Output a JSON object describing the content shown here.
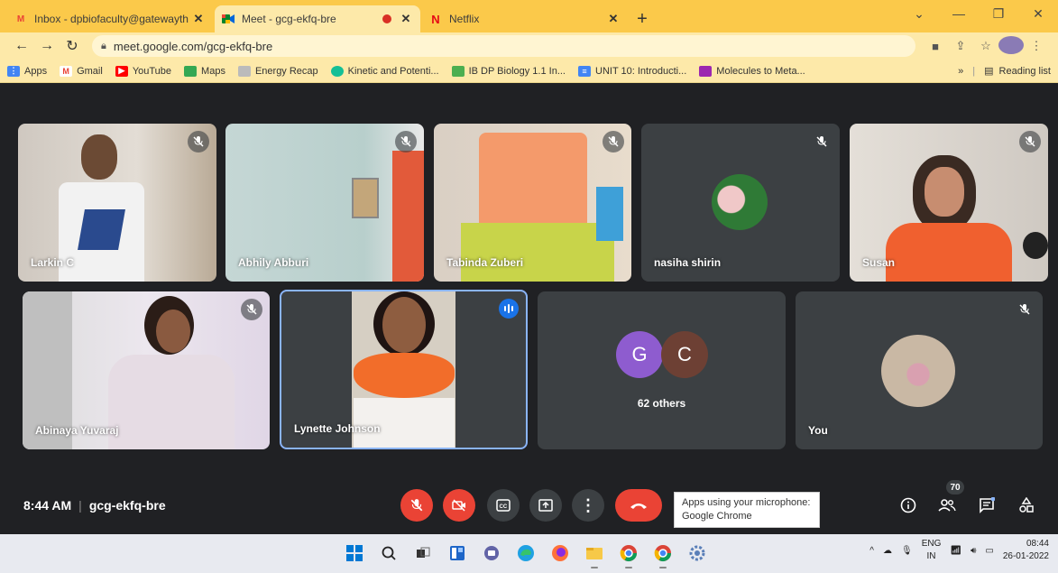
{
  "browser": {
    "tabs": [
      {
        "title": "Inbox - dpbiofaculty@gatewayth",
        "favicon": "gmail-icon",
        "active": false
      },
      {
        "title": "Meet - gcg-ekfq-bre",
        "favicon": "meet-icon",
        "active": true
      },
      {
        "title": "Netflix",
        "favicon": "netflix-icon",
        "active": false
      }
    ],
    "url": "meet.google.com/gcg-ekfq-bre",
    "bookmarks": [
      {
        "label": "Apps",
        "icon": "apps-icon",
        "color": "#4285f4"
      },
      {
        "label": "Gmail",
        "icon": "gmail-icon",
        "color": "#ea4335"
      },
      {
        "label": "YouTube",
        "icon": "youtube-icon",
        "color": "#ff0000"
      },
      {
        "label": "Maps",
        "icon": "maps-icon",
        "color": "#34a853"
      },
      {
        "label": "Energy Recap",
        "icon": "energy-icon",
        "color": "#999999"
      },
      {
        "label": "Kinetic and Potenti...",
        "icon": "khan-icon",
        "color": "#14bf96"
      },
      {
        "label": "IB DP Biology 1.1 In...",
        "icon": "slides-icon",
        "color": "#4caf50"
      },
      {
        "label": "UNIT 10: Introducti...",
        "icon": "docs-icon",
        "color": "#4285f4"
      },
      {
        "label": "Molecules to Meta...",
        "icon": "molecule-icon",
        "color": "#9c27b0"
      }
    ],
    "reading_list": "Reading list",
    "overflow": "»"
  },
  "participants": [
    {
      "name": "Larkin C",
      "muted": true
    },
    {
      "name": "Abhily Abburi",
      "muted": true
    },
    {
      "name": "Tabinda Zuberi",
      "muted": true
    },
    {
      "name": "nasiha shirin",
      "muted": true
    },
    {
      "name": "Susan",
      "muted": true
    },
    {
      "name": "Abinaya Yuvaraj",
      "muted": true
    },
    {
      "name": "Lynette Johnson",
      "muted": false,
      "speaking": true
    },
    {
      "name": "62 others",
      "initials": [
        "G",
        "C"
      ],
      "muted": false
    },
    {
      "name": "You",
      "muted": true
    }
  ],
  "bottom_bar": {
    "time": "8:44 AM",
    "meeting_code": "gcg-ekfq-bre",
    "tooltip": "Apps using your microphone: Google Chrome",
    "people_count": "70"
  },
  "taskbar": {
    "lang": "ENG",
    "region": "IN",
    "time": "08:44",
    "date": "26-01-2022"
  },
  "colors": {
    "accent_blue": "#1a73e8",
    "red": "#ea4335",
    "tab_bar": "#fbc94a"
  }
}
